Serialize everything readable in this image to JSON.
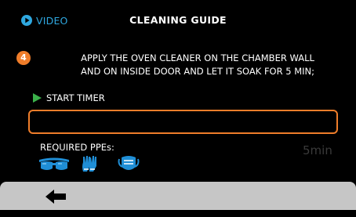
{
  "header": {
    "video_label": "VIDEO",
    "title": "CLEANING GUIDE"
  },
  "step": {
    "number": "4",
    "instruction_lines": [
      "APPLY THE OVEN CLEANER ON THE CHAMBER WALL",
      "AND ON INSIDE DOOR AND LET IT SOAK FOR 5 MIN;"
    ]
  },
  "timer": {
    "start_label": "START TIMER",
    "value": "",
    "duration": "5min"
  },
  "ppe": {
    "label": "REQUIRED PPEs:",
    "icons": [
      "safety-goggles-icon",
      "gloves-icon",
      "face-mask-icon"
    ]
  },
  "colors": {
    "accent_orange": "#ef7d2a",
    "video_blue": "#2fa8e0",
    "play_green": "#3bb04a",
    "ppe_blue": "#1f8ed6",
    "footer_gray": "#c6c6c6"
  },
  "footer": {
    "back_icon": "arrow-left-icon"
  }
}
